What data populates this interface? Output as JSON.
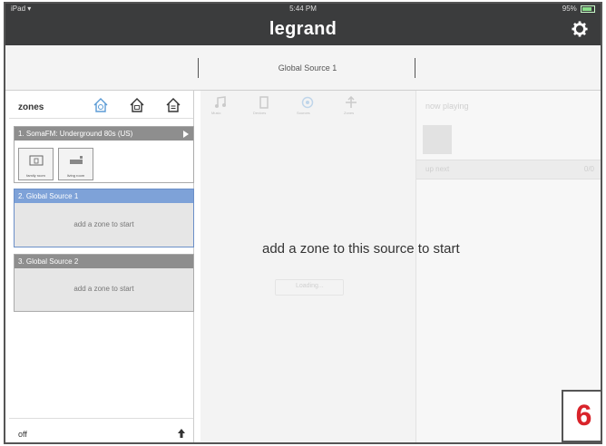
{
  "status_bar": {
    "device": "iPad",
    "wifi_icon": "wifi-icon",
    "time": "5:44 PM",
    "battery": "95%"
  },
  "header": {
    "title": "legrand",
    "settings_icon": "gear-icon"
  },
  "tabs": {
    "active": "Global Source 1"
  },
  "sidebar": {
    "title": "zones",
    "header_icons": [
      "home-active-icon",
      "home-dimmed-icon",
      "home-outline-icon"
    ],
    "zones": [
      {
        "header": "1. SomaFM: Underground 80s (US)",
        "playing": true,
        "rooms": [
          {
            "label": "family room"
          },
          {
            "label": "living room"
          }
        ]
      },
      {
        "header": "2. Global Source 1",
        "selected": true,
        "empty_text": "add a zone to start"
      },
      {
        "header": "3. Global Source 2",
        "empty_text": "add a zone to start"
      }
    ],
    "footer": {
      "label": "off"
    }
  },
  "main": {
    "message": "add a zone to this source to start",
    "toolbar_ghost": [
      "Music",
      "Devices",
      "Sources",
      "Zones"
    ],
    "loading_text": "Loading...",
    "now_playing": {
      "title": "now playing",
      "up_next": "up next",
      "up_next_right": "0/0"
    }
  },
  "step_badge": {
    "number": "6",
    "color": "#d9232a"
  },
  "colors": {
    "topbar": "#3b3c3d",
    "selected_zone": "#7ea2d8",
    "zone_header": "#8e8e8e"
  }
}
